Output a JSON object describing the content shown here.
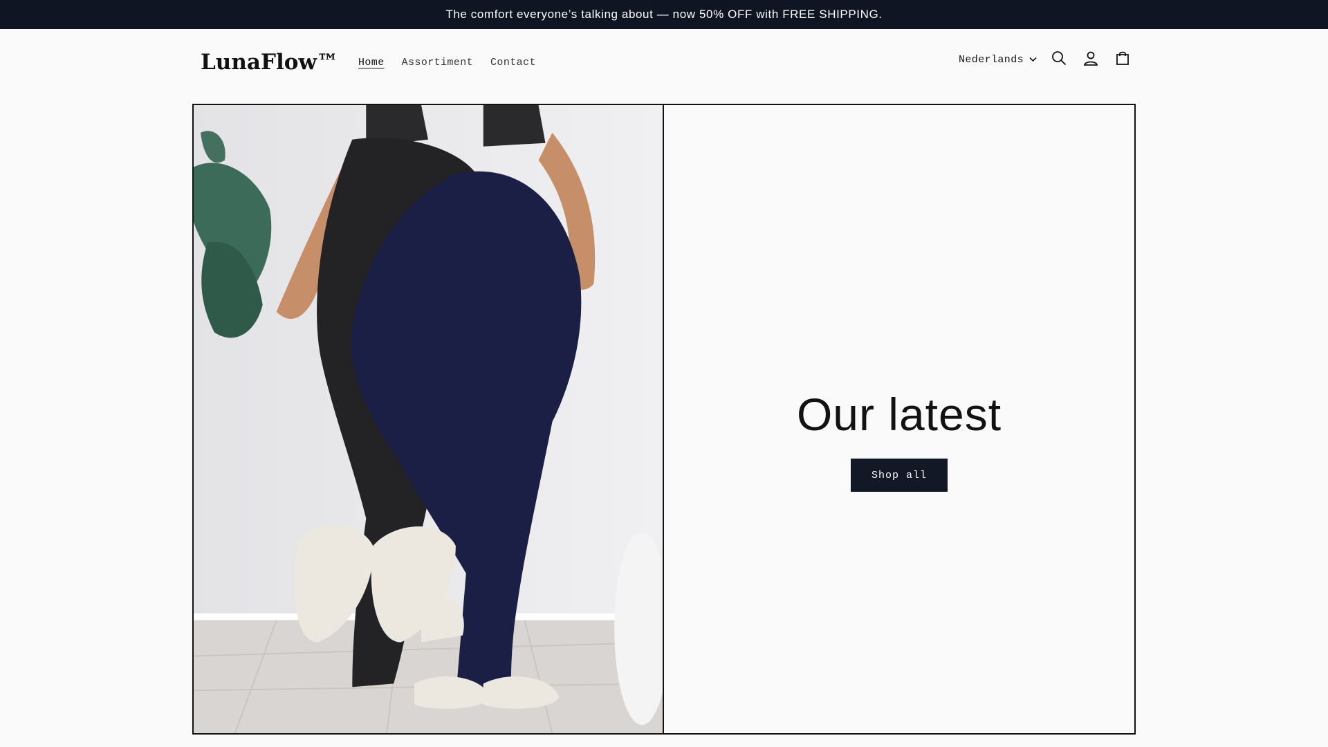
{
  "announcement": "The comfort everyone’s talking about — now 50% OFF with FREE SHIPPING.",
  "header": {
    "logo": "LunaFlow™",
    "nav": [
      {
        "label": "Home",
        "active": true
      },
      {
        "label": "Assortiment",
        "active": false
      },
      {
        "label": "Contact",
        "active": false
      }
    ],
    "language": "Nederlands",
    "icons": [
      "chevron-down-icon",
      "search-icon",
      "account-icon",
      "cart-icon"
    ]
  },
  "hero": {
    "image_alt": "Two models wearing black and navy flared leggings with white sneakers",
    "headline": "Our latest",
    "cta_label": "Shop all"
  },
  "colors": {
    "announcement_bg": "#0f1522",
    "button_bg": "#121826",
    "navy_product": "#1c1f45"
  }
}
